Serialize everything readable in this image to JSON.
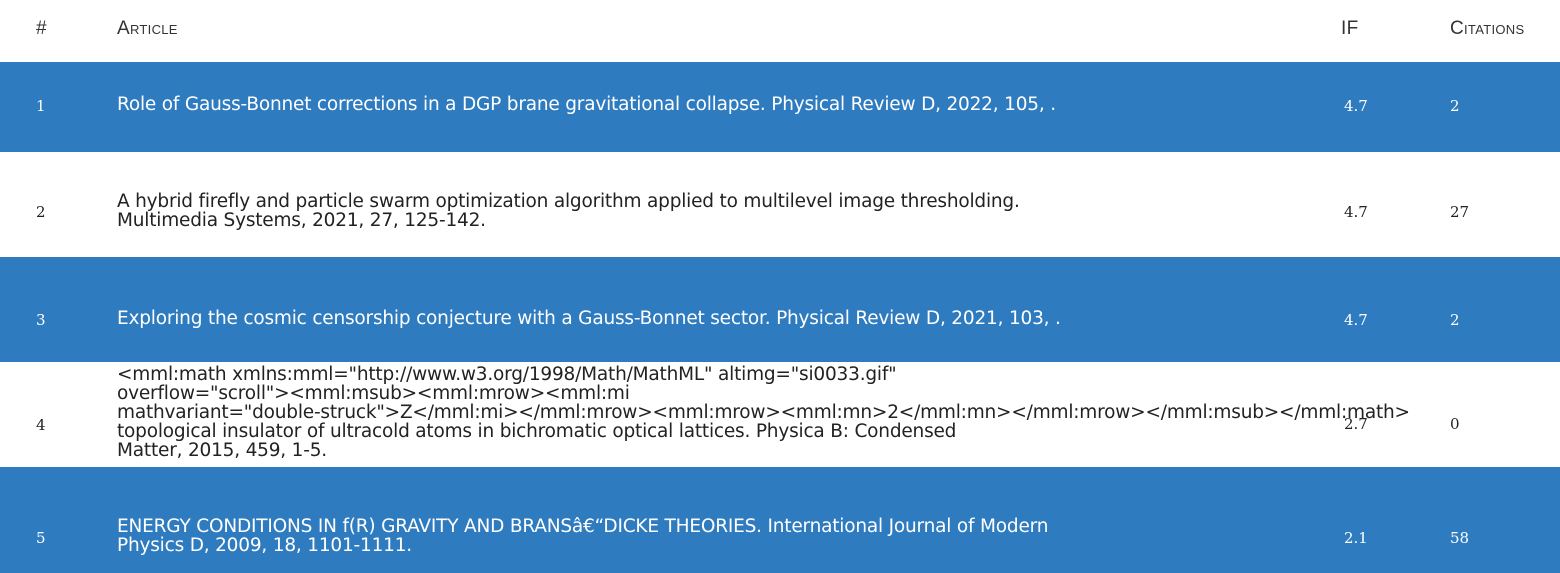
{
  "table": {
    "headers": {
      "num": "#",
      "article": "Article",
      "if": "IF",
      "citations": "Citations"
    },
    "rows": [
      {
        "num": "1",
        "article": "Role of Gauss-Bonnet corrections in a DGP brane gravitational collapse. Physical Review D, 2022, 105, .",
        "if": "4.7",
        "citations": "2"
      },
      {
        "num": "2",
        "article_line1": "A hybrid firefly and particle swarm optimization algorithm applied to multilevel image thresholding.",
        "article_line2": "Multimedia Systems, 2021, 27, 125-142.",
        "if": "4.7",
        "citations": "27"
      },
      {
        "num": "3",
        "article": "Exploring the cosmic censorship conjecture with a Gauss-Bonnet sector. Physical Review D, 2021, 103, .",
        "if": "4.7",
        "citations": "2"
      },
      {
        "num": "4",
        "article_line1": "<mml:math xmlns:mml=\"http://www.w3.org/1998/Math/MathML\" altimg=\"si0033.gif\"",
        "article_line2": "overflow=\"scroll\"><mml:msub><mml:mrow><mml:mi",
        "article_line3": "mathvariant=\"double-struck\">Z</mml:mi></mml:mrow><mml:mrow><mml:mn>2</mml:mn></mml:mrow></mml:msub></mml:math>",
        "article_line4": "topological insulator of ultracold atoms in bichromatic optical lattices. Physica B: Condensed",
        "article_line5": "Matter, 2015, 459, 1-5.",
        "if": "2.7",
        "citations": "0"
      },
      {
        "num": "5",
        "article_line1": "ENERGY CONDITIONS IN f(R) GRAVITY AND BRANSâ€“DICKE THEORIES. International Journal of Modern",
        "article_line2": "Physics D, 2009, 18, 1101-1111.",
        "if": "2.1",
        "citations": "58"
      }
    ]
  },
  "colors": {
    "row_highlight": "#2e7bc0",
    "text_dark": "#222222",
    "text_on_highlight": "#ffffff"
  }
}
